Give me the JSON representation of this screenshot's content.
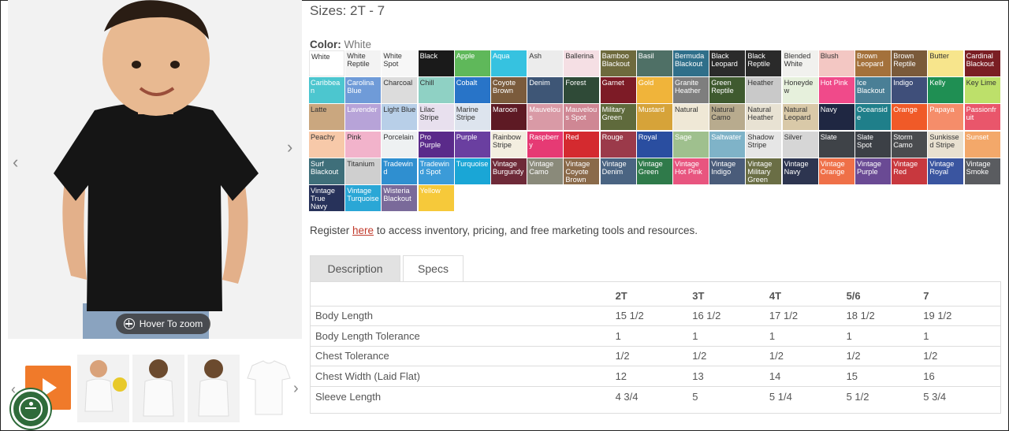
{
  "product": {
    "sizes_label": "Sizes: 2T - 7",
    "color_label": "Color:",
    "color_value": "White",
    "hover_zoom": "Hover To zoom"
  },
  "gallery": {
    "prev_icon": "chevron-left-icon",
    "next_icon": "chevron-right-icon",
    "thumbs_next_icon": "chevron-right-icon"
  },
  "colors": [
    {
      "name": "White",
      "bg": "#ffffff",
      "fg": "#333"
    },
    {
      "name": "White Reptile",
      "bg": "#f3f3f3",
      "fg": "#333"
    },
    {
      "name": "White Spot",
      "bg": "#f7f7f7",
      "fg": "#333"
    },
    {
      "name": "Black",
      "bg": "#1a1a1a",
      "fg": "#fff"
    },
    {
      "name": "Apple",
      "bg": "#5fb85a",
      "fg": "#fff"
    },
    {
      "name": "Aqua",
      "bg": "#36c2e0",
      "fg": "#fff"
    },
    {
      "name": "Ash",
      "bg": "#ececec",
      "fg": "#333"
    },
    {
      "name": "Ballerina",
      "bg": "#f5dfe4",
      "fg": "#333"
    },
    {
      "name": "Bamboo Blackout",
      "bg": "#6e6a3d",
      "fg": "#fff"
    },
    {
      "name": "Basil",
      "bg": "#4f7066",
      "fg": "#fff"
    },
    {
      "name": "Bermuda Blackout",
      "bg": "#2f6f8a",
      "fg": "#fff"
    },
    {
      "name": "Black Leopard",
      "bg": "#2b2b2b",
      "fg": "#fff"
    },
    {
      "name": "Black Reptile",
      "bg": "#2a2a2a",
      "fg": "#fff"
    },
    {
      "name": "Blended White",
      "bg": "#f1f1ee",
      "fg": "#333"
    },
    {
      "name": "Blush",
      "bg": "#f3c7c3",
      "fg": "#333"
    },
    {
      "name": "Brown Leopard",
      "bg": "#a4713b",
      "fg": "#fff"
    },
    {
      "name": "Brown Reptile",
      "bg": "#7a5a3a",
      "fg": "#fff"
    },
    {
      "name": "Butter",
      "bg": "#f7e58c",
      "fg": "#333"
    },
    {
      "name": "Cardinal Blackout",
      "bg": "#7a1e24",
      "fg": "#fff"
    },
    {
      "name": "Caribbean",
      "bg": "#4cc6cf",
      "fg": "#fff"
    },
    {
      "name": "Carolina Blue",
      "bg": "#6f9bd8",
      "fg": "#fff"
    },
    {
      "name": "Charcoal",
      "bg": "#dcdcdc",
      "fg": "#333"
    },
    {
      "name": "Chill",
      "bg": "#8fd1c4",
      "fg": "#333"
    },
    {
      "name": "Cobalt",
      "bg": "#2874c8",
      "fg": "#fff"
    },
    {
      "name": "Coyote Brown",
      "bg": "#7b5b3c",
      "fg": "#fff"
    },
    {
      "name": "Denim",
      "bg": "#3e5676",
      "fg": "#fff"
    },
    {
      "name": "Forest",
      "bg": "#2f4a37",
      "fg": "#fff"
    },
    {
      "name": "Garnet",
      "bg": "#7d1b26",
      "fg": "#fff"
    },
    {
      "name": "Gold",
      "bg": "#f0b43a",
      "fg": "#fff"
    },
    {
      "name": "Granite Heather",
      "bg": "#7e7e7e",
      "fg": "#fff"
    },
    {
      "name": "Green Reptile",
      "bg": "#3f5a2f",
      "fg": "#fff"
    },
    {
      "name": "Heather",
      "bg": "#c9c9c9",
      "fg": "#333"
    },
    {
      "name": "Honeydew",
      "bg": "#e6f0dc",
      "fg": "#333"
    },
    {
      "name": "Hot Pink",
      "bg": "#f04a8a",
      "fg": "#fff"
    },
    {
      "name": "Ice Blackout",
      "bg": "#4a7f96",
      "fg": "#fff"
    },
    {
      "name": "Indigo",
      "bg": "#3f4f7a",
      "fg": "#fff"
    },
    {
      "name": "Kelly",
      "bg": "#1f8f53",
      "fg": "#fff"
    },
    {
      "name": "Key Lime",
      "bg": "#bde06a",
      "fg": "#333"
    },
    {
      "name": "Latte",
      "bg": "#caa77f",
      "fg": "#333"
    },
    {
      "name": "Lavender",
      "bg": "#b7a3d8",
      "fg": "#fff"
    },
    {
      "name": "Light Blue",
      "bg": "#b8cfe8",
      "fg": "#333"
    },
    {
      "name": "Lilac Stripe",
      "bg": "#e8e0ee",
      "fg": "#333"
    },
    {
      "name": "Marine Stripe",
      "bg": "#dde4ee",
      "fg": "#333"
    },
    {
      "name": "Maroon",
      "bg": "#5e1a24",
      "fg": "#fff"
    },
    {
      "name": "Mauvelous",
      "bg": "#d99aa6",
      "fg": "#fff"
    },
    {
      "name": "Mauvelous Spot",
      "bg": "#cf8794",
      "fg": "#fff"
    },
    {
      "name": "Military Green",
      "bg": "#5f6a3c",
      "fg": "#fff"
    },
    {
      "name": "Mustard",
      "bg": "#d6a339",
      "fg": "#fff"
    },
    {
      "name": "Natural",
      "bg": "#efe8d6",
      "fg": "#333"
    },
    {
      "name": "Natural Camo",
      "bg": "#b8ab8e",
      "fg": "#333"
    },
    {
      "name": "Natural Heather",
      "bg": "#e8e2d3",
      "fg": "#333"
    },
    {
      "name": "Natural Leopard",
      "bg": "#d9c9a8",
      "fg": "#333"
    },
    {
      "name": "Navy",
      "bg": "#1f2742",
      "fg": "#fff"
    },
    {
      "name": "Oceanside",
      "bg": "#1f7f8a",
      "fg": "#fff"
    },
    {
      "name": "Orange",
      "bg": "#f05a28",
      "fg": "#fff"
    },
    {
      "name": "Papaya",
      "bg": "#f58d6a",
      "fg": "#fff"
    },
    {
      "name": "Passionfruit",
      "bg": "#e9566b",
      "fg": "#fff"
    },
    {
      "name": "Peachy",
      "bg": "#f7c9a9",
      "fg": "#333"
    },
    {
      "name": "Pink",
      "bg": "#f2b3cb",
      "fg": "#333"
    },
    {
      "name": "Porcelain",
      "bg": "#eef1f2",
      "fg": "#333"
    },
    {
      "name": "Pro Purple",
      "bg": "#5a2a8a",
      "fg": "#fff"
    },
    {
      "name": "Purple",
      "bg": "#6a3fa0",
      "fg": "#fff"
    },
    {
      "name": "Rainbow Stripe",
      "bg": "#f3eee0",
      "fg": "#333"
    },
    {
      "name": "Raspberry",
      "bg": "#e63a74",
      "fg": "#fff"
    },
    {
      "name": "Red",
      "bg": "#d42a2f",
      "fg": "#fff"
    },
    {
      "name": "Rouge",
      "bg": "#9b3a4a",
      "fg": "#fff"
    },
    {
      "name": "Royal",
      "bg": "#2a4ea0",
      "fg": "#fff"
    },
    {
      "name": "Sage",
      "bg": "#9fc08e",
      "fg": "#fff"
    },
    {
      "name": "Saltwater",
      "bg": "#7fb3c8",
      "fg": "#fff"
    },
    {
      "name": "Shadow Stripe",
      "bg": "#e6e6e6",
      "fg": "#333"
    },
    {
      "name": "Silver",
      "bg": "#d6d6d6",
      "fg": "#333"
    },
    {
      "name": "Slate",
      "bg": "#3f4348",
      "fg": "#fff"
    },
    {
      "name": "Slate Spot",
      "bg": "#3c4046",
      "fg": "#fff"
    },
    {
      "name": "Storm Camo",
      "bg": "#4a4c4f",
      "fg": "#fff"
    },
    {
      "name": "Sunkissed Stripe",
      "bg": "#e8e0d0",
      "fg": "#333"
    },
    {
      "name": "Sunset",
      "bg": "#f3a86a",
      "fg": "#fff"
    },
    {
      "name": "Surf Blackout",
      "bg": "#3f6f7a",
      "fg": "#fff"
    },
    {
      "name": "Titanium",
      "bg": "#cfcfcf",
      "fg": "#333"
    },
    {
      "name": "Tradewind",
      "bg": "#2f8fd0",
      "fg": "#fff"
    },
    {
      "name": "Tradewind Spot",
      "bg": "#3b9bd8",
      "fg": "#fff"
    },
    {
      "name": "Turquoise",
      "bg": "#1aa6d6",
      "fg": "#fff"
    },
    {
      "name": "Vintage Burgundy",
      "bg": "#6e2a38",
      "fg": "#fff"
    },
    {
      "name": "Vintage Camo",
      "bg": "#8a8a7a",
      "fg": "#fff"
    },
    {
      "name": "Vintage Coyote Brown",
      "bg": "#8a6a4a",
      "fg": "#fff"
    },
    {
      "name": "Vintage Denim",
      "bg": "#4a6482",
      "fg": "#fff"
    },
    {
      "name": "Vintage Green",
      "bg": "#2f7a4a",
      "fg": "#fff"
    },
    {
      "name": "Vintage Hot Pink",
      "bg": "#e8557f",
      "fg": "#fff"
    },
    {
      "name": "Vintage Indigo",
      "bg": "#4a5c7a",
      "fg": "#fff"
    },
    {
      "name": "Vintage Military Green",
      "bg": "#6a6e45",
      "fg": "#fff"
    },
    {
      "name": "Vintage Navy",
      "bg": "#2d3550",
      "fg": "#fff"
    },
    {
      "name": "Vintage Orange",
      "bg": "#ef7048",
      "fg": "#fff"
    },
    {
      "name": "Vintage Purple",
      "bg": "#6a4a94",
      "fg": "#fff"
    },
    {
      "name": "Vintage Red",
      "bg": "#c8383e",
      "fg": "#fff"
    },
    {
      "name": "Vintage Royal",
      "bg": "#3a55a0",
      "fg": "#fff"
    },
    {
      "name": "Vintage Smoke",
      "bg": "#5a5c60",
      "fg": "#fff"
    },
    {
      "name": "Vintage True Navy",
      "bg": "#27325a",
      "fg": "#fff"
    },
    {
      "name": "Vintage Turquoise",
      "bg": "#2aa7d6",
      "fg": "#fff"
    },
    {
      "name": "Wisteria Blackout",
      "bg": "#7a6a9a",
      "fg": "#fff"
    },
    {
      "name": "Yellow",
      "bg": "#f6c93a",
      "fg": "#fff"
    }
  ],
  "register": {
    "before": "Register ",
    "link": "here",
    "after": " to access inventory, pricing, and free marketing tools and resources."
  },
  "tabs": {
    "description": "Description",
    "specs": "Specs"
  },
  "specs": {
    "headers": [
      "",
      "2T",
      "3T",
      "4T",
      "5/6",
      "7"
    ],
    "rows": [
      [
        "Body Length",
        "15 1/2",
        "16 1/2",
        "17 1/2",
        "18 1/2",
        "19 1/2"
      ],
      [
        "Body Length Tolerance",
        "1",
        "1",
        "1",
        "1",
        "1"
      ],
      [
        "Chest Tolerance",
        "1/2",
        "1/2",
        "1/2",
        "1/2",
        "1/2"
      ],
      [
        "Chest Width (Laid Flat)",
        "12",
        "13",
        "14",
        "15",
        "16"
      ],
      [
        "Sleeve Length",
        "4 3/4",
        "5",
        "5 1/4",
        "5 1/2",
        "5 3/4"
      ]
    ]
  }
}
